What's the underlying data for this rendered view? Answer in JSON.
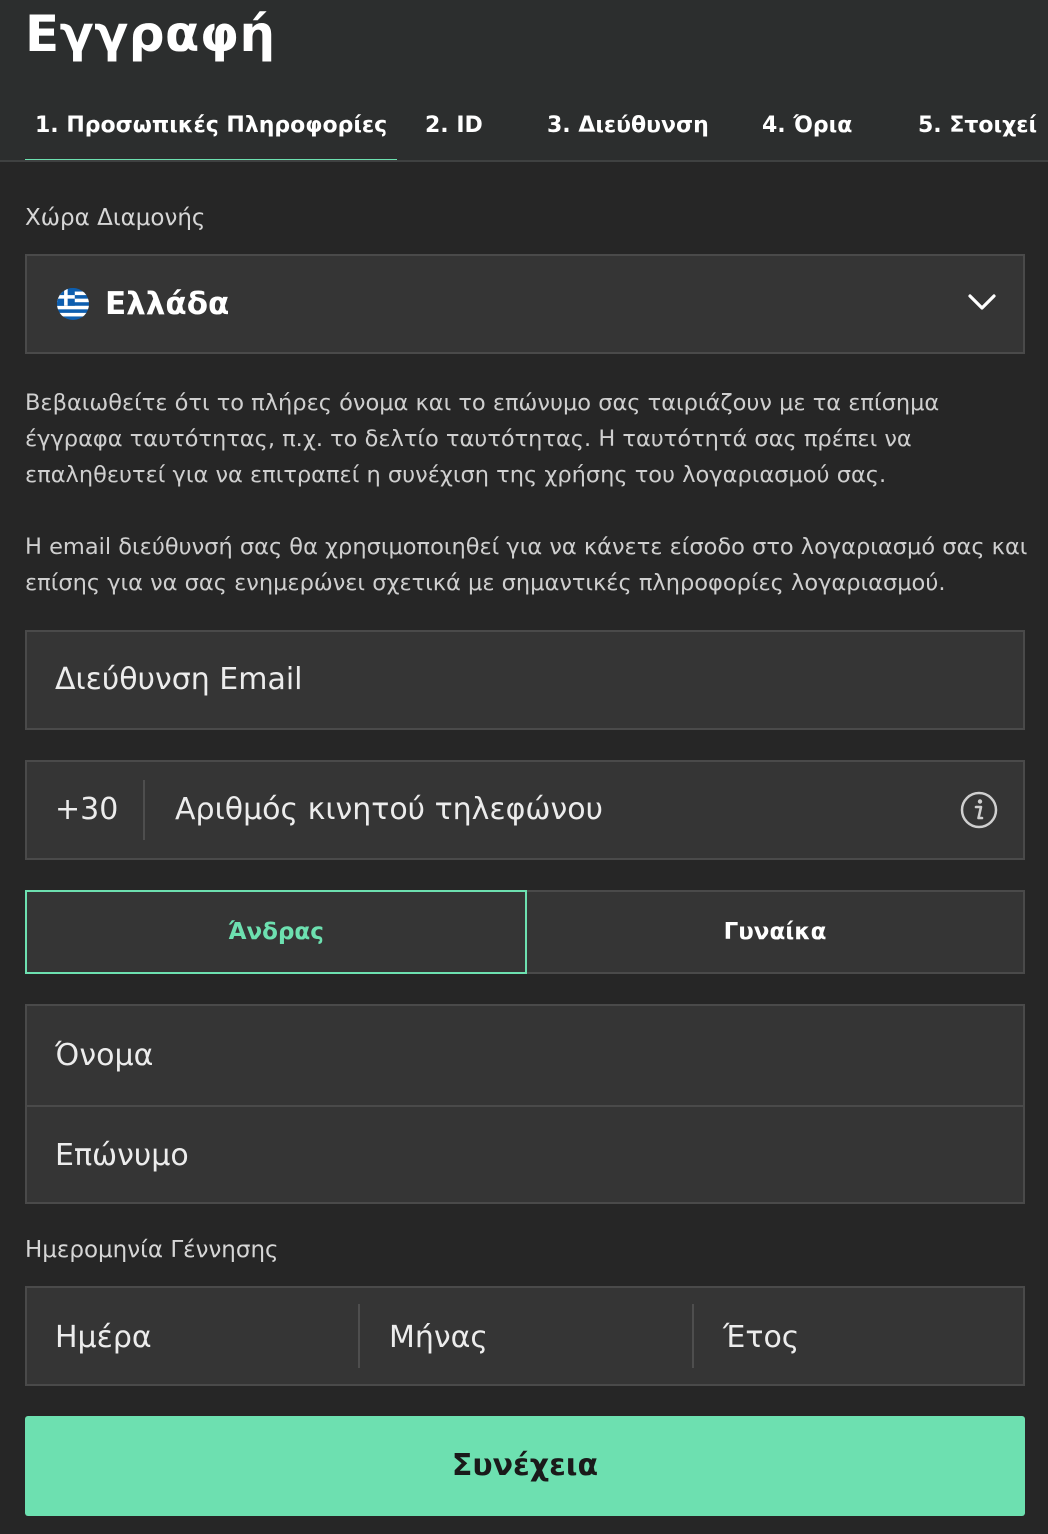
{
  "header": {
    "title": "Εγγραφή",
    "tabs": [
      {
        "label": "1. Προσωπικές Πληροφορίες",
        "active": true
      },
      {
        "label": "2. ID"
      },
      {
        "label": "3. Διεύθυνση"
      },
      {
        "label": "4. Όρια"
      },
      {
        "label": "5. Στοιχεί"
      }
    ]
  },
  "country": {
    "label": "Χώρα Διαμονής",
    "value": "Ελλάδα",
    "flag_icon": "greece-flag-icon"
  },
  "notices": {
    "name_notice": "Βεβαιωθείτε ότι το πλήρες όνομα και το επώνυμο σας ταιριάζουν με τα επίσημα έγγραφα ταυτότητας, π.χ. το δελτίο ταυτότητας. Η ταυτότητά σας πρέπει να επαληθευτεί για να επιτραπεί η συνέχιση της χρήσης του λογαριασμού σας.",
    "email_notice": "Η email διεύθυνσή σας θα χρησιμοποιηθεί για να κάνετε είσοδο στο λογαριασμό σας και επίσης για να σας ενημερώνει σχετικά με σημαντικές πληροφορίες λογαριασμού."
  },
  "email": {
    "placeholder": "Διεύθυνση Email"
  },
  "phone": {
    "prefix": "+30",
    "placeholder": "Αριθμός κινητού τηλεφώνου"
  },
  "gender": {
    "male": "Άνδρας",
    "female": "Γυναίκα",
    "selected": "male"
  },
  "name": {
    "first_placeholder": "Όνομα",
    "last_placeholder": "Επώνυμο"
  },
  "dob": {
    "label": "Ημερομηνία Γέννησης",
    "day": "Ημέρα",
    "month": "Μήνας",
    "year": "Έτος"
  },
  "continue_label": "Συνέχεια",
  "colors": {
    "accent": "#6de0b0",
    "background": "#262626",
    "field": "#353535"
  }
}
